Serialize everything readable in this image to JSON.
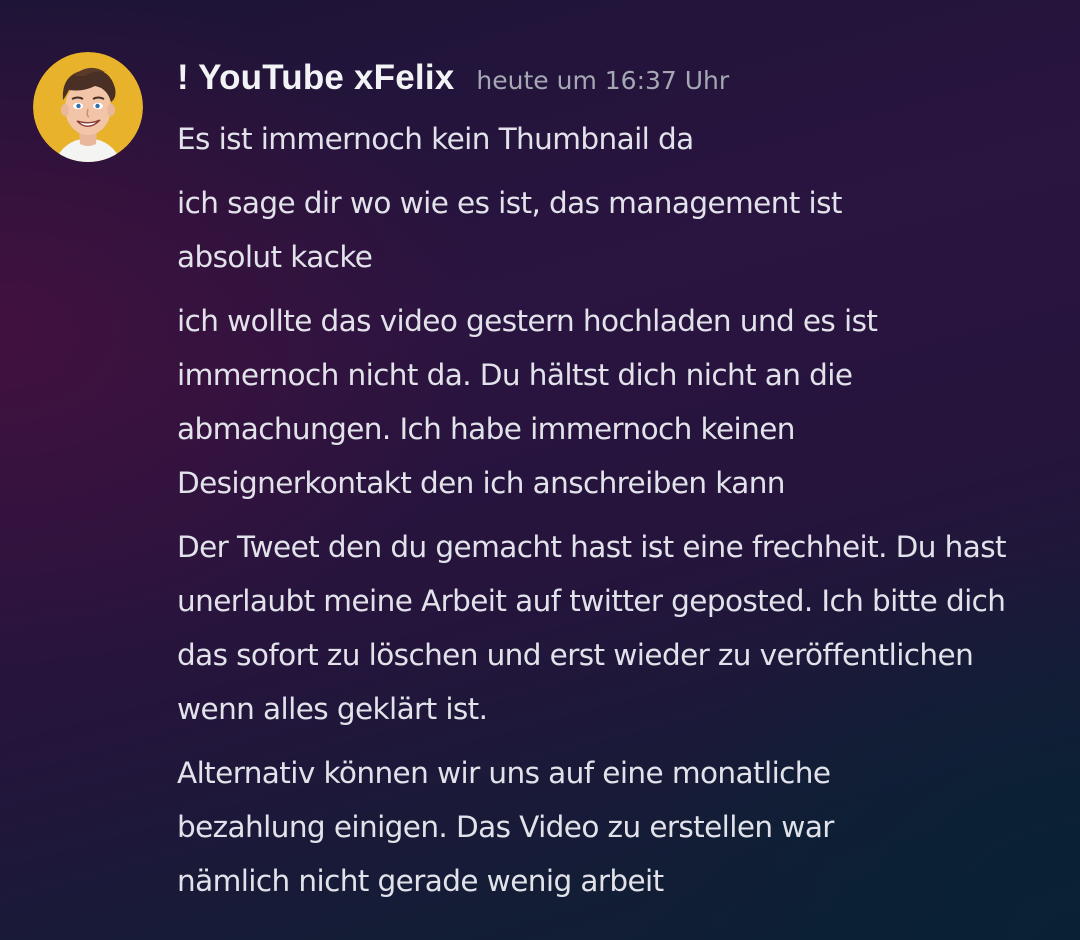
{
  "message": {
    "username": "! YouTube xFelix",
    "timestamp": "heute um 16:37 Uhr",
    "lines": [
      "Es ist immernoch kein Thumbnail da",
      "ich sage dir wo wie es ist, das management ist absolut kacke",
      "ich wollte das video gestern hochladen und es ist immernoch nicht da. Du hältst dich nicht an die abmachungen. Ich habe immernoch keinen Designerkontakt den ich anschreiben kann",
      "Der Tweet den du gemacht hast ist eine frechheit. Du hast unerlaubt meine Arbeit auf twitter geposted. Ich bitte dich das sofort zu löschen und erst wieder zu veröffentlichen wenn alles geklärt ist.",
      "Alternativ können wir uns auf eine monatliche bezahlung einigen. Das Video zu erstellen war nämlich nicht gerade wenig arbeit"
    ]
  },
  "colors": {
    "username": "#f2f3f5",
    "timestamp": "#a5a7b3",
    "text": "#e2e3ea",
    "avatar_bg": "#e8b22a"
  },
  "icons": {
    "avatar": "cartoon-avatar-icon"
  }
}
